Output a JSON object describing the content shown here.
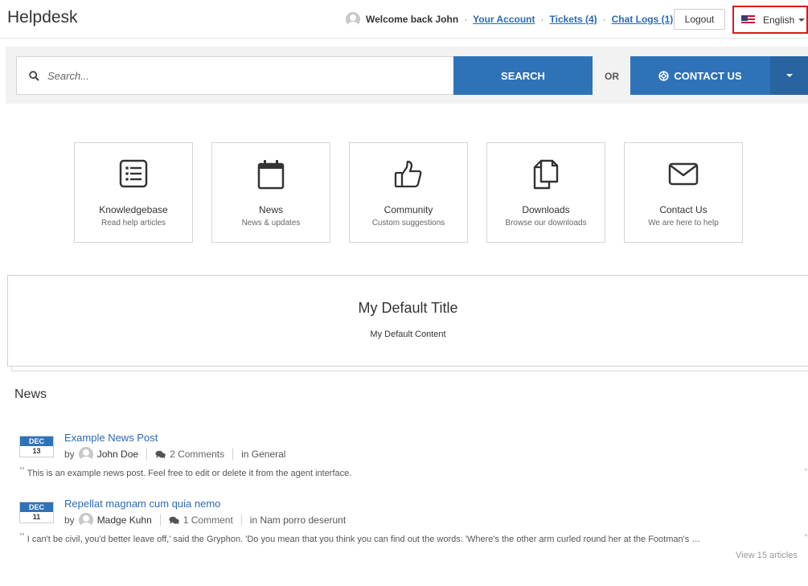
{
  "header": {
    "brand": "Helpdesk",
    "welcome": "Welcome back John",
    "account_link": "Your Account",
    "tickets_link": "Tickets (4)",
    "chat_logs_link": "Chat Logs (1)",
    "logout": "Logout",
    "language": "English"
  },
  "search": {
    "placeholder": "Search...",
    "button": "SEARCH",
    "or": "OR",
    "contact_button": "CONTACT US"
  },
  "tiles": [
    {
      "title": "Knowledgebase",
      "subtitle": "Read help articles",
      "icon": "list-icon"
    },
    {
      "title": "News",
      "subtitle": "News & updates",
      "icon": "calendar-icon"
    },
    {
      "title": "Community",
      "subtitle": "Custom suggestions",
      "icon": "thumbs-up-icon"
    },
    {
      "title": "Downloads",
      "subtitle": "Browse our downloads",
      "icon": "files-icon"
    },
    {
      "title": "Contact Us",
      "subtitle": "We are here to help",
      "icon": "envelope-icon"
    }
  ],
  "default_block": {
    "title": "My Default Title",
    "content": "My Default Content"
  },
  "news": {
    "heading": "News",
    "items": [
      {
        "month": "DEC",
        "day": "13",
        "title": "Example News Post",
        "by": "by",
        "author": "John Doe",
        "comments": "2 Comments",
        "category": "in General",
        "excerpt": "This is an example news post. Feel free to edit or delete it from the agent interface."
      },
      {
        "month": "DEC",
        "day": "11",
        "title": "Repellat magnam cum quia nemo",
        "by": "by",
        "author": "Madge Kuhn",
        "comments": "1 Comment",
        "category": "in Nam porro deserunt",
        "excerpt": "I can't be civil, you'd better leave off,' said the Gryphon. 'Do you mean that you think you can find out the words: 'Where's the other arm curled round her at the Footman's …"
      }
    ],
    "view_all": "View 15 articles"
  },
  "colors": {
    "primary": "#2e73b8",
    "link": "#2a6ab5",
    "highlight_border": "#e0161b"
  }
}
